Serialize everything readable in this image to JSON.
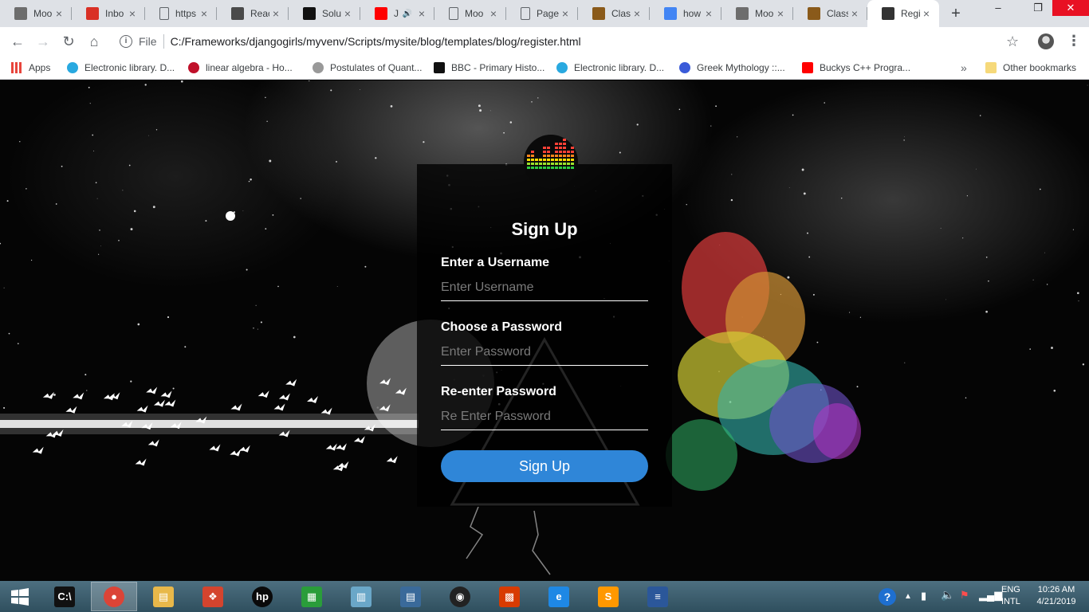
{
  "browser": {
    "tabs": [
      {
        "title": "Moo",
        "icon": "moodle-icon",
        "icon_color": "#6d6d6d"
      },
      {
        "title": "Inbo",
        "icon": "gmail-icon",
        "icon_color": "#d93025"
      },
      {
        "title": "https",
        "icon": "document-icon",
        "icon_color": "#5f6368"
      },
      {
        "title": "Reac",
        "icon": "react-icon",
        "icon_color": "#4a4a4a"
      },
      {
        "title": "Solu",
        "icon": "s-logo-icon",
        "icon_color": "#111111"
      },
      {
        "title": "J",
        "icon": "youtube-icon",
        "icon_color": "#ff0000",
        "audio": true
      },
      {
        "title": "Moo",
        "icon": "document-icon",
        "icon_color": "#5f6368"
      },
      {
        "title": "Page",
        "icon": "document-icon",
        "icon_color": "#5f6368"
      },
      {
        "title": "Class",
        "icon": "class-icon",
        "icon_color": "#8a5a1a"
      },
      {
        "title": "how",
        "icon": "google-icon",
        "icon_color": "#4285f4"
      },
      {
        "title": "Moo",
        "icon": "moodle-icon",
        "icon_color": "#6d6d6d"
      },
      {
        "title": "Class",
        "icon": "class-icon",
        "icon_color": "#8a5a1a"
      },
      {
        "title": "Regi",
        "icon": "bird-icon",
        "icon_color": "#333333",
        "active": true
      }
    ],
    "url_scheme_label": "File",
    "url": "C:/Frameworks/djangogirls/myvenv/Scripts/mysite/blog/templates/blog/register.html",
    "bookmarks": [
      {
        "label": "Apps",
        "icon": "apps-icon",
        "color": "#e8453c"
      },
      {
        "label": "Electronic library. D...",
        "icon": "globe-icon",
        "color": "#29a9e0"
      },
      {
        "label": "linear algebra - Ho...",
        "icon": "flower-icon",
        "color": "#c0102a"
      },
      {
        "label": "Postulates of Quant...",
        "icon": "sparkle-icon",
        "color": "#999999"
      },
      {
        "label": "BBC - Primary Histo...",
        "icon": "bbc-icon",
        "color": "#111111"
      },
      {
        "label": "Electronic library. D...",
        "icon": "globe-icon",
        "color": "#29a9e0"
      },
      {
        "label": "Greek Mythology ::...",
        "icon": "g-icon",
        "color": "#3a5bd9"
      },
      {
        "label": "Buckys C++ Progra...",
        "icon": "youtube-icon",
        "color": "#ff0000"
      }
    ],
    "other_bookmarks": "Other bookmarks"
  },
  "form": {
    "title": "Sign Up",
    "username_label": "Enter a Username",
    "username_placeholder": "Enter Username",
    "password_label": "Choose a Password",
    "password_placeholder": "Enter Password",
    "repassword_label": "Re-enter Password",
    "repassword_placeholder": "Re Enter Password",
    "submit_label": "Sign Up",
    "accent_color": "#2f86d8"
  },
  "taskbar": {
    "apps": [
      {
        "name": "cmd",
        "icon": "cmd-icon"
      },
      {
        "name": "chrome",
        "icon": "chrome-icon",
        "active": true
      },
      {
        "name": "explorer",
        "icon": "folder-icon"
      },
      {
        "name": "puzzle",
        "icon": "puzzle-icon"
      },
      {
        "name": "hp",
        "icon": "hp-icon"
      },
      {
        "name": "store",
        "icon": "store-icon"
      },
      {
        "name": "notepad",
        "icon": "book-icon"
      },
      {
        "name": "reader",
        "icon": "reader-icon"
      },
      {
        "name": "camera",
        "icon": "camera-icon"
      },
      {
        "name": "office",
        "icon": "office-icon"
      },
      {
        "name": "ie",
        "icon": "ie-icon"
      },
      {
        "name": "sublime",
        "icon": "sublime-icon"
      },
      {
        "name": "word",
        "icon": "document-icon"
      }
    ],
    "lang_top": "ENG",
    "lang_bottom": "INTL",
    "time": "10:26 AM",
    "date": "4/21/2019"
  }
}
